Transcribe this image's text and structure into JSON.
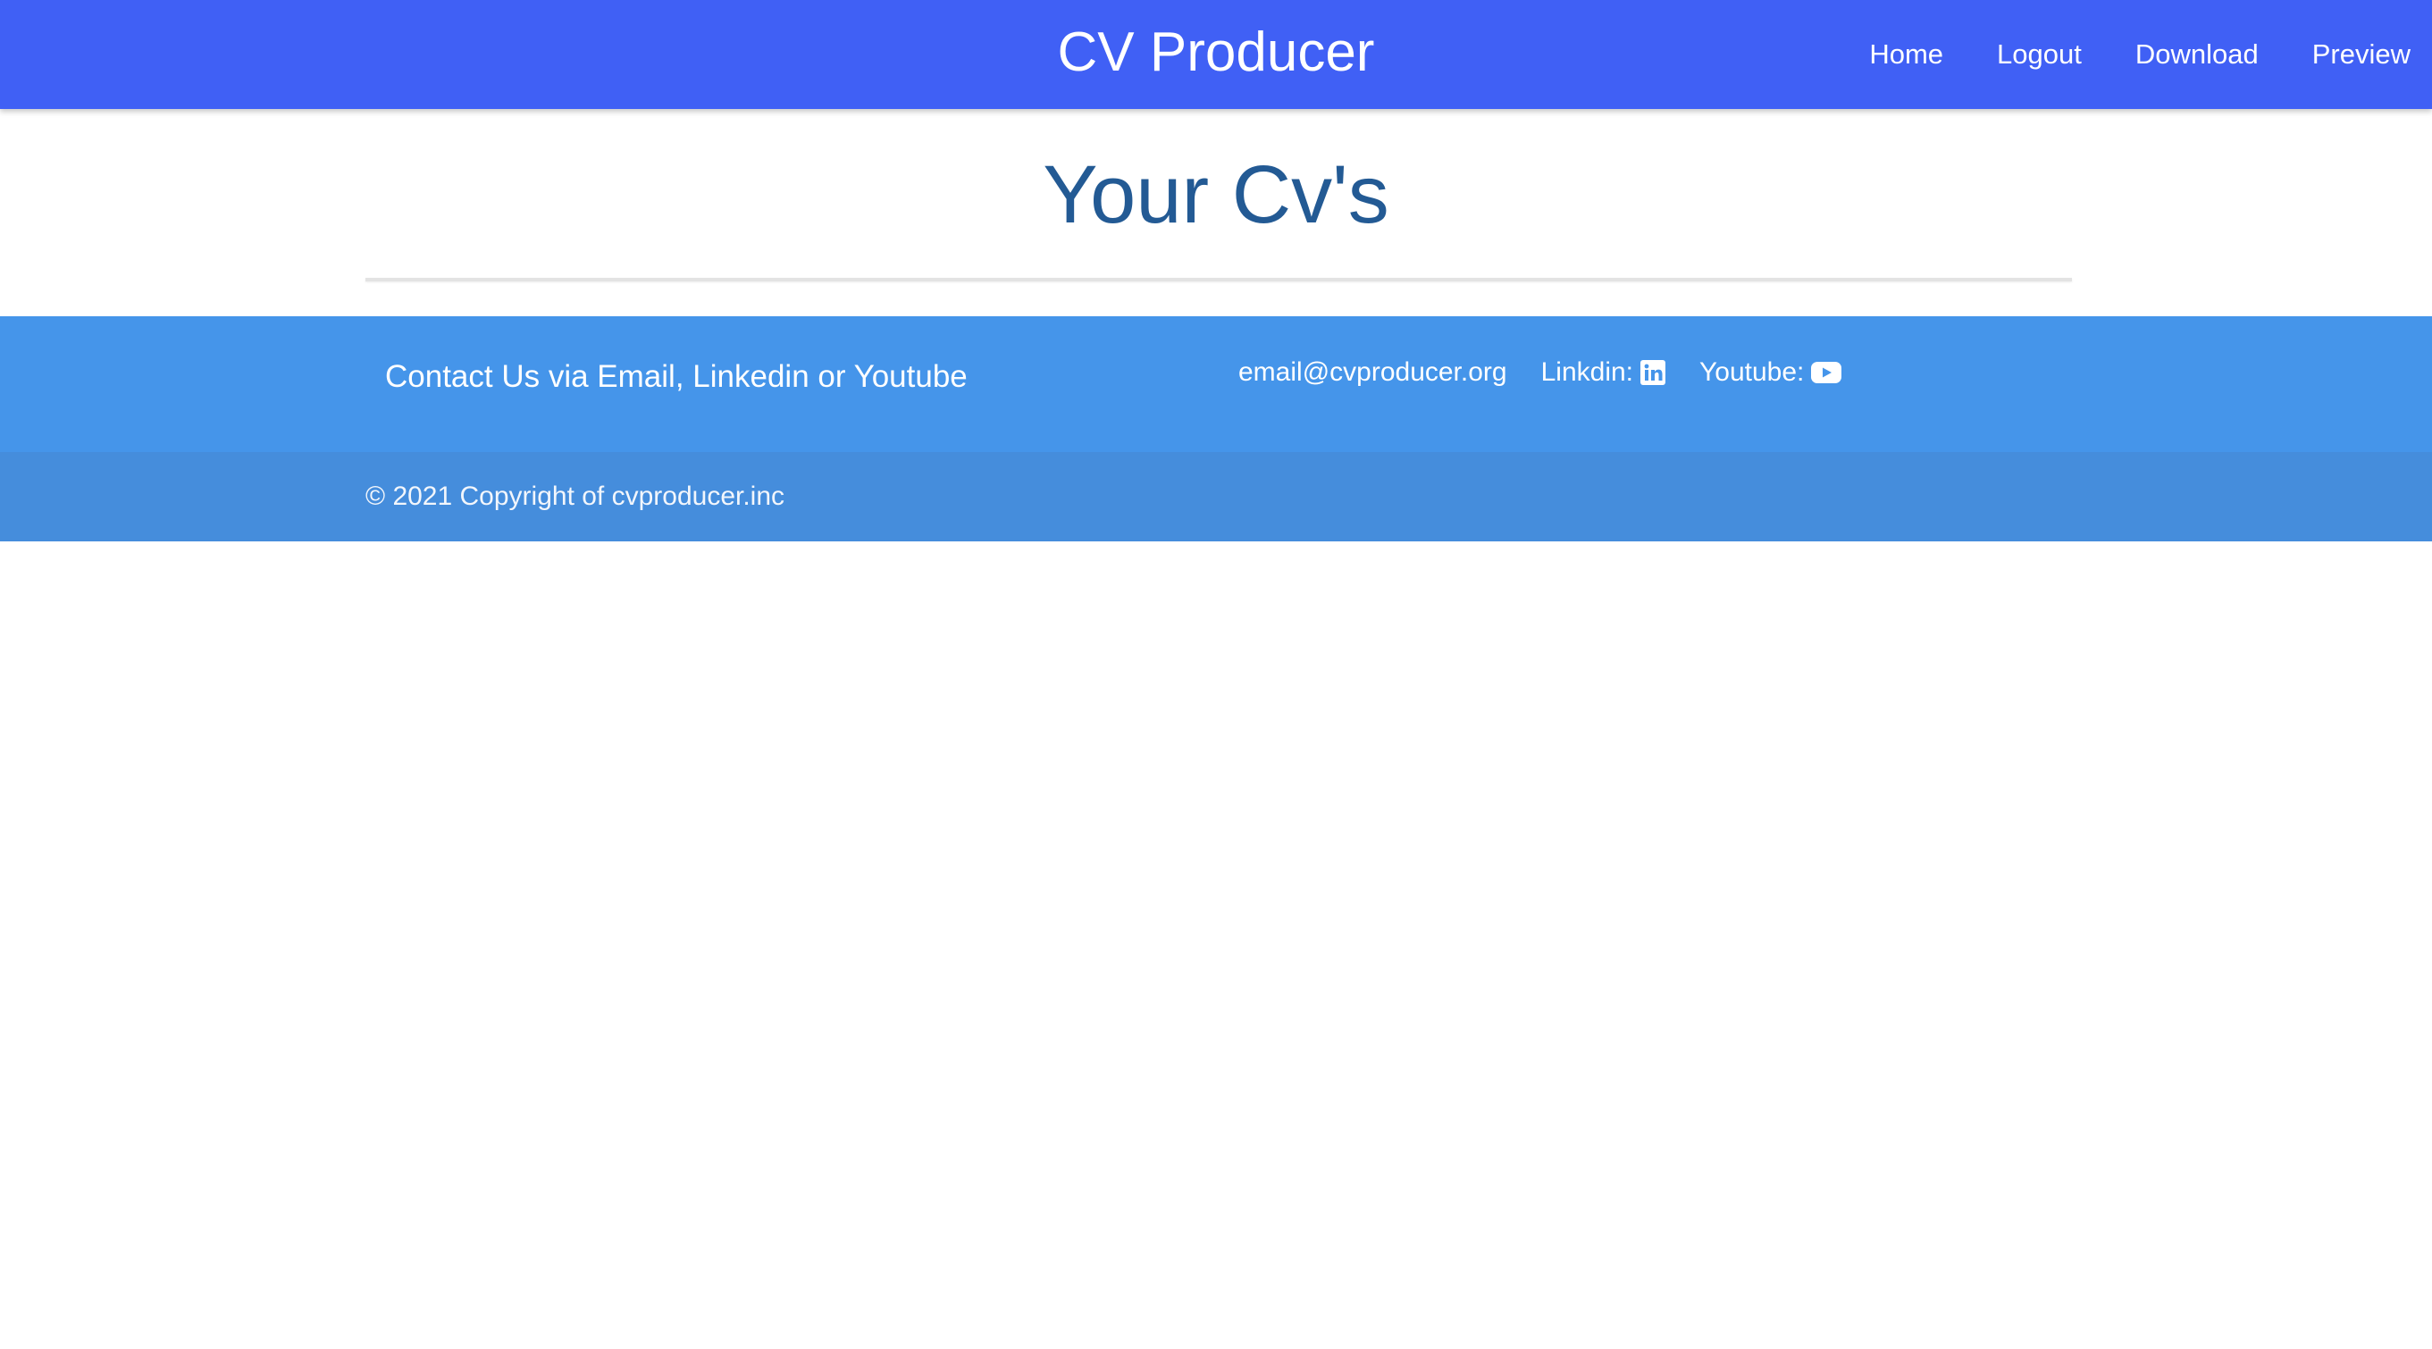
{
  "navbar": {
    "brand": "CV Producer",
    "links": [
      "Home",
      "Logout",
      "Download",
      "Preview"
    ]
  },
  "main": {
    "title": "Your Cv's"
  },
  "footer": {
    "contact_heading": "Contact Us via Email, Linkedin or Youtube",
    "email": "email@cvproducer.org",
    "linkedin_label": "Linkdin:",
    "youtube_label": "Youtube:",
    "copyright": "© 2021 Copyright of cvproducer.inc"
  },
  "icons": {
    "linkedin": "linkedin-icon",
    "youtube": "youtube-icon"
  },
  "colors": {
    "navbar_bg": "#4060f5",
    "title_text": "#235a94",
    "footer_bg": "#4595ea",
    "footer_bottom_bg": "#458ddc"
  }
}
